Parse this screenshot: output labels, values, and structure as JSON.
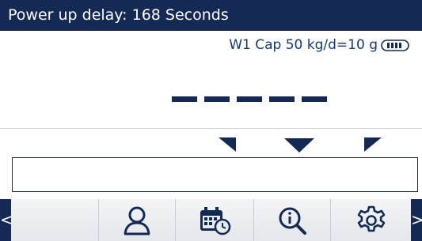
{
  "status_bar": {
    "message": "Power up delay: 168 Seconds"
  },
  "scale_info": {
    "capacity_text": "W1 Cap 50 kg/d=10 g",
    "icon": "battery-icon"
  },
  "weight_display": {
    "value": "-----",
    "state": "power-up-delay"
  },
  "input_field": {
    "value": ""
  },
  "softkeys": {
    "left_arrow": "<",
    "right_arrow": ">",
    "items": [
      {
        "name": "user",
        "icon": "user-icon"
      },
      {
        "name": "calendar",
        "icon": "calendar-clock-icon"
      },
      {
        "name": "info",
        "icon": "info-recall-icon"
      },
      {
        "name": "setup",
        "icon": "gear-icon"
      }
    ]
  },
  "colors": {
    "primary": "#142a55",
    "background": "#ffffff",
    "softkey_bg": "#e9ecef"
  }
}
